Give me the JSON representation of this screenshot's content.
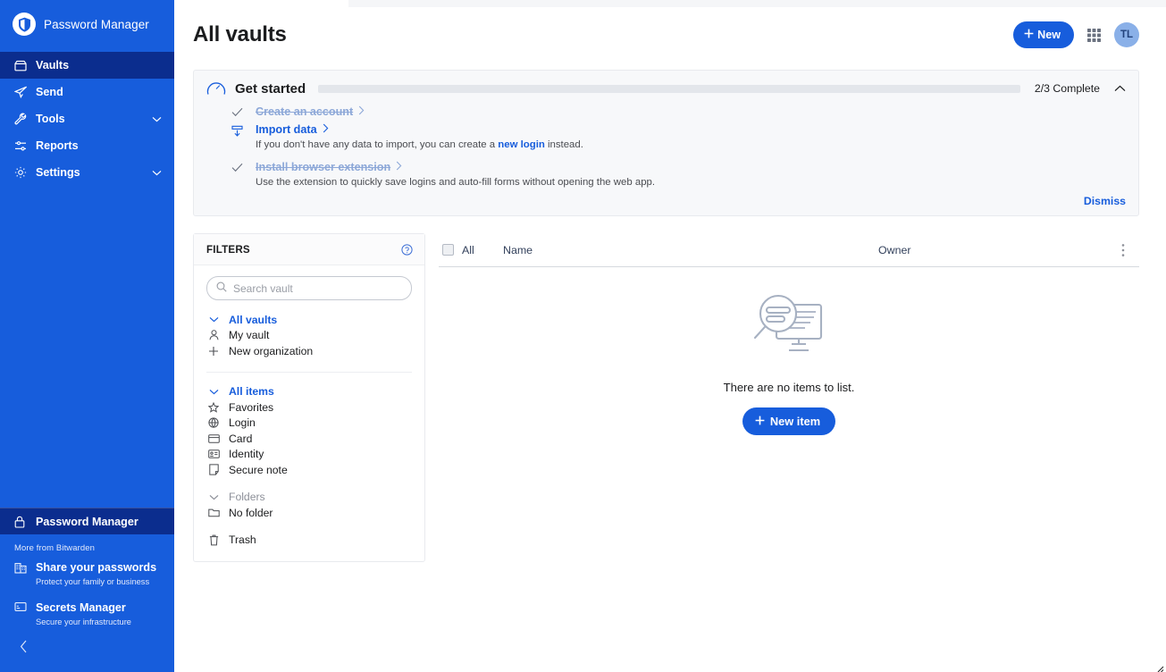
{
  "colors": {
    "brand_blue": "#175ddc",
    "sidebar_active": "#0b2d8e",
    "page_bg": "#f5f6f8",
    "card_bg": "#f7f8fa",
    "text_dark": "#1b1c1e",
    "muted": "#8d9099",
    "done_strike": "#8da8d8",
    "avatar_bg": "#8ab0e8"
  },
  "sidebar": {
    "brand": {
      "name": "Password Manager",
      "logo_icon": "bitwarden-shield-icon"
    },
    "items": [
      {
        "label": "Vaults",
        "icon": "vault-icon",
        "active": true,
        "chevron": false
      },
      {
        "label": "Send",
        "icon": "send-icon",
        "active": false,
        "chevron": false
      },
      {
        "label": "Tools",
        "icon": "tools-icon",
        "active": false,
        "chevron": true
      },
      {
        "label": "Reports",
        "icon": "reports-icon",
        "active": false,
        "chevron": false
      },
      {
        "label": "Settings",
        "icon": "gear-icon",
        "active": false,
        "chevron": true
      }
    ],
    "product_switcher": {
      "label": "Password Manager",
      "icon": "lock-icon"
    },
    "more_label": "More from Bitwarden",
    "promos": [
      {
        "title": "Share your passwords",
        "subtitle": "Protect your family or business",
        "icon": "organization-icon"
      },
      {
        "title": "Secrets Manager",
        "subtitle": "Secure your infrastructure",
        "icon": "secrets-manager-icon"
      }
    ],
    "collapse_icon": "chevron-left-icon"
  },
  "header": {
    "title": "All vaults",
    "new_button": {
      "label": "New",
      "icon": "plus-icon"
    },
    "apps_icon": "app-grid-icon",
    "avatar": {
      "initials": "TL"
    }
  },
  "get_started": {
    "icon": "gauge-icon",
    "title": "Get started",
    "progress_percent": 66.6,
    "status": "2/3 Complete",
    "collapse_icon": "chevron-up-icon",
    "steps": [
      {
        "title": "Create an account",
        "completed": true,
        "icon": "check-icon",
        "chevron": "chevron-right-icon",
        "description": "",
        "description_link": "",
        "description_tail": ""
      },
      {
        "title": "Import data",
        "completed": false,
        "icon": "import-icon",
        "chevron": "chevron-right-icon",
        "description": "If you don't have any data to import, you can create a ",
        "description_link": "new login",
        "description_tail": " instead."
      },
      {
        "title": "Install browser extension",
        "completed": true,
        "icon": "check-icon",
        "chevron": "chevron-right-icon",
        "description": "Use the extension to quickly save logins and auto-fill forms without opening the web app.",
        "description_link": "",
        "description_tail": ""
      }
    ],
    "dismiss_label": "Dismiss"
  },
  "filters": {
    "title": "FILTERS",
    "help_icon": "help-circle-icon",
    "search": {
      "placeholder": "Search vault",
      "value": "",
      "icon": "search-icon"
    },
    "vault_group": [
      {
        "label": "All vaults",
        "icon": "chevron-down-icon",
        "is_header": true,
        "muted": false
      },
      {
        "label": "My vault",
        "icon": "user-icon",
        "is_header": false,
        "muted": false
      },
      {
        "label": "New organization",
        "icon": "plus-icon",
        "is_header": false,
        "muted": false
      }
    ],
    "item_group": [
      {
        "label": "All items",
        "icon": "chevron-down-icon",
        "is_header": true,
        "muted": false
      },
      {
        "label": "Favorites",
        "icon": "star-icon",
        "is_header": false,
        "muted": false
      },
      {
        "label": "Login",
        "icon": "globe-icon",
        "is_header": false,
        "muted": false
      },
      {
        "label": "Card",
        "icon": "credit-card-icon",
        "is_header": false,
        "muted": false
      },
      {
        "label": "Identity",
        "icon": "id-card-icon",
        "is_header": false,
        "muted": false
      },
      {
        "label": "Secure note",
        "icon": "note-icon",
        "is_header": false,
        "muted": false
      }
    ],
    "folder_group": [
      {
        "label": "Folders",
        "icon": "chevron-down-icon",
        "is_header": true,
        "muted": true
      },
      {
        "label": "No folder",
        "icon": "folder-icon",
        "is_header": false,
        "muted": false
      }
    ],
    "trash": {
      "label": "Trash",
      "icon": "trash-icon"
    }
  },
  "items_table": {
    "select_all_label": "All",
    "columns": [
      "Name",
      "Owner"
    ],
    "options_icon": "vertical-dots-icon",
    "rows": [],
    "empty": {
      "illustration": "no-items-search-monitor-illustration",
      "message": "There are no items to list.",
      "action": {
        "label": "New item",
        "icon": "plus-icon"
      }
    }
  }
}
